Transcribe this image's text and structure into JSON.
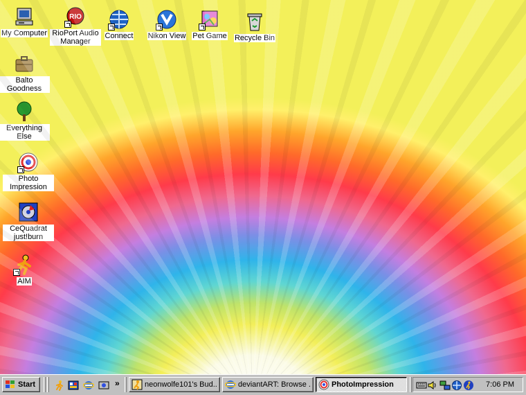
{
  "desktop": {
    "icons": [
      {
        "label": "My Computer",
        "icon": "my-computer-icon"
      },
      {
        "label": "RioPort Audio Manager",
        "icon": "rioport-icon"
      },
      {
        "label": "Connect",
        "icon": "connect-globe-icon"
      },
      {
        "label": "Nikon View",
        "icon": "nikon-view-icon"
      },
      {
        "label": "Pet Game",
        "icon": "pet-game-icon"
      },
      {
        "label": "Recycle Bin",
        "icon": "recycle-bin-icon"
      },
      {
        "label": "Balto Goodness",
        "icon": "briefcase-icon"
      },
      {
        "label": "Everything Else",
        "icon": "tree-icon"
      },
      {
        "label": "Photo Impression",
        "icon": "photoimpression-icon"
      },
      {
        "label": "CeQuadrat just!burn",
        "icon": "justburn-icon"
      },
      {
        "label": "AIM",
        "icon": "aim-runner-icon"
      }
    ]
  },
  "taskbar": {
    "start_label": "Start",
    "quicklaunch_more": "»",
    "tasks": [
      {
        "label": "neonwolfe101's Bud...",
        "icon": "aim-buddy-icon",
        "active": false
      },
      {
        "label": "deviantART: Browse ...",
        "icon": "ie-icon",
        "active": false
      },
      {
        "label": "PhotoImpression",
        "icon": "photoimpression-icon",
        "active": true
      }
    ],
    "clock": "7:06 PM"
  },
  "colors": {
    "taskbar": "#c0c0c0",
    "label_bg": "#ffffff"
  }
}
